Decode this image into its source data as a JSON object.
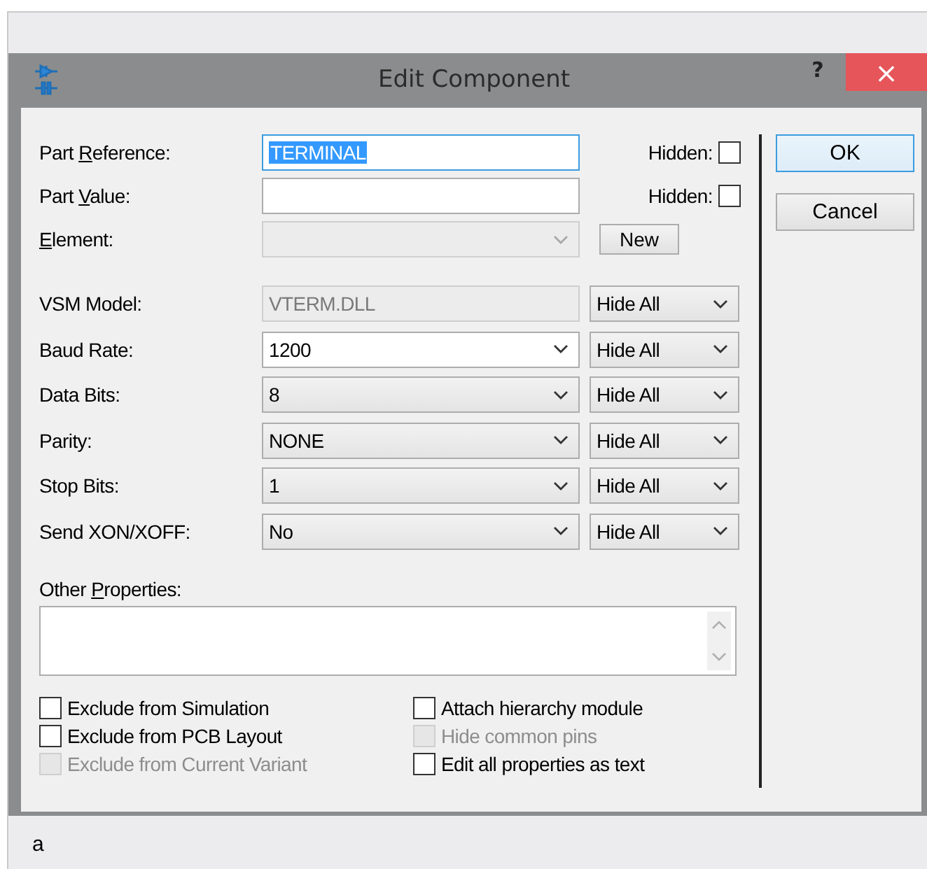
{
  "window": {
    "title": "Edit Component",
    "help": "?",
    "close": "×"
  },
  "header_fields": [
    {
      "kind": "text",
      "label": {
        "before": "Part ",
        "key": "R",
        "after": "eference:"
      },
      "value": "TERMINAL",
      "focused": true,
      "text_selected": true,
      "hidden": {
        "label": "Hidden:",
        "checked": false
      }
    },
    {
      "kind": "text",
      "label": {
        "before": "Part ",
        "key": "V",
        "after": "alue:"
      },
      "focused": false,
      "text_selected": false,
      "hidden": {
        "label": "Hidden:",
        "checked": false
      }
    },
    {
      "kind": "combo",
      "label": {
        "key": "E",
        "after": "lement:"
      },
      "disabled": true,
      "button": "New"
    }
  ],
  "properties": [
    {
      "label": "VSM Model:",
      "kind": "text",
      "value": "VTERM.DLL",
      "disabled": true,
      "visibility": "Hide All"
    },
    {
      "label": "Baud Rate:",
      "kind": "combo",
      "value": "1200",
      "disabled": false,
      "visibility": "Hide All"
    },
    {
      "label": "Data Bits:",
      "kind": "list",
      "value": "8",
      "disabled": false,
      "visibility": "Hide All"
    },
    {
      "label": "Parity:",
      "kind": "list",
      "value": "NONE",
      "disabled": false,
      "visibility": "Hide All"
    },
    {
      "label": "Stop Bits:",
      "kind": "list",
      "value": "1",
      "disabled": false,
      "visibility": "Hide All"
    },
    {
      "label": "Send XON/XOFF:",
      "kind": "list",
      "value": "No",
      "disabled": false,
      "visibility": "Hide All"
    }
  ],
  "other_properties": {
    "label": {
      "before": "Other ",
      "key": "P",
      "after": "roperties:"
    }
  },
  "options": [
    [
      {
        "label": "Exclude from Simulation",
        "checked": false,
        "disabled": false
      },
      {
        "label": "Exclude from PCB Layout",
        "checked": false,
        "disabled": false
      },
      {
        "label": "Exclude from Current Variant",
        "checked": false,
        "disabled": true
      }
    ],
    [
      {
        "label": "Attach hierarchy module",
        "checked": false,
        "disabled": false
      },
      {
        "label": "Hide common pins",
        "checked": false,
        "disabled": true
      },
      {
        "label": "Edit all properties as text",
        "checked": false,
        "disabled": false
      }
    ]
  ],
  "buttons": [
    {
      "label": "OK",
      "default": true
    },
    {
      "label": "Cancel",
      "default": false
    }
  ],
  "caption": "a"
}
